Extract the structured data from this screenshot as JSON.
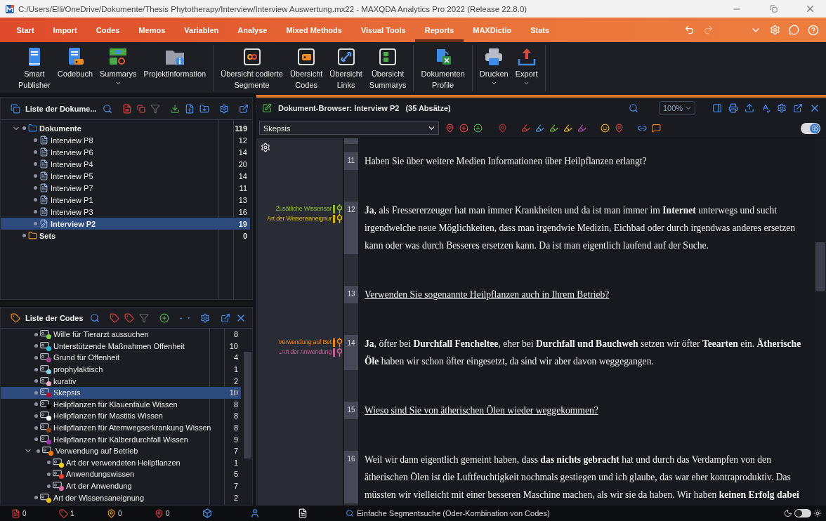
{
  "window": {
    "title": "C:/Users/Elli/OneDrive/Dokumente/Thesis Phytotherapy/Interview/Interview Auswertung.mx22 - MAXQDA Analytics Pro 2022 (Release 22.8.0)"
  },
  "menu_tabs": [
    {
      "label": "Start",
      "selected": false
    },
    {
      "label": "Import",
      "selected": false
    },
    {
      "label": "Codes",
      "selected": false
    },
    {
      "label": "Memos",
      "selected": false
    },
    {
      "label": "Variablen",
      "selected": false
    },
    {
      "label": "Analyse",
      "selected": false
    },
    {
      "label": "Mixed Methods",
      "selected": false
    },
    {
      "label": "Visual Tools",
      "selected": false
    },
    {
      "label": "Reports",
      "selected": true
    },
    {
      "label": "MAXDictio",
      "selected": false
    },
    {
      "label": "Stats",
      "selected": false
    }
  ],
  "ribbon": {
    "groups": [
      [
        {
          "lines": [
            "Smart",
            "Publisher"
          ],
          "dropdown": false
        },
        {
          "lines": [
            "Codebuch"
          ],
          "dropdown": false
        },
        {
          "lines": [
            "Summarys"
          ],
          "dropdown": true
        },
        {
          "lines": [
            "Projektinformation"
          ],
          "dropdown": false
        }
      ],
      [
        {
          "lines": [
            "Übersicht codierte",
            "Segmente"
          ],
          "dropdown": false
        },
        {
          "lines": [
            "Übersicht",
            "Codes"
          ],
          "dropdown": false
        },
        {
          "lines": [
            "Übersicht",
            "Links"
          ],
          "dropdown": false
        },
        {
          "lines": [
            "Übersicht",
            "Summarys"
          ],
          "dropdown": false
        }
      ],
      [
        {
          "lines": [
            "Dokumenten",
            "Profile"
          ],
          "dropdown": false
        }
      ],
      [
        {
          "lines": [
            "Drucken"
          ],
          "dropdown": true
        },
        {
          "lines": [
            "Export"
          ],
          "dropdown": true
        }
      ]
    ]
  },
  "documents_panel": {
    "title": "Liste der Dokume...",
    "tree": [
      {
        "label": "Dokumente",
        "count": "119",
        "kind": "folder",
        "expanded": true,
        "selected": false,
        "children": [
          {
            "label": "Interview P8",
            "count": "12",
            "kind": "document",
            "selected": false
          },
          {
            "label": "Interview P6",
            "count": "14",
            "kind": "document",
            "selected": false
          },
          {
            "label": "Interview P4",
            "count": "20",
            "kind": "document",
            "selected": false
          },
          {
            "label": "Interview P5",
            "count": "14",
            "kind": "document",
            "selected": false
          },
          {
            "label": "Interview P7",
            "count": "11",
            "kind": "document",
            "selected": false
          },
          {
            "label": "Interview P1",
            "count": "13",
            "kind": "document",
            "selected": false
          },
          {
            "label": "Interview P3",
            "count": "16",
            "kind": "document",
            "selected": false
          },
          {
            "label": "Interview P2",
            "count": "19",
            "kind": "document",
            "selected": true
          }
        ]
      },
      {
        "label": "Sets",
        "count": "0",
        "kind": "set",
        "selected": false
      }
    ]
  },
  "codes_panel": {
    "title": "Liste der Codes",
    "tree": [
      {
        "label": "Wille für Tierarzt aussuchen",
        "count": "8",
        "color": "#7cd34a",
        "selected": false
      },
      {
        "label": "Unterstützende Maßnahmen Offenheit",
        "count": "10",
        "color": "#22c3e0",
        "selected": false
      },
      {
        "label": "Grund für Offenheit",
        "count": "4",
        "color": "#a8408f",
        "selected": false
      },
      {
        "label": "prophylaktisch",
        "count": "1",
        "color": "#7fd3e6",
        "selected": false
      },
      {
        "label": "kurativ",
        "count": "2",
        "color": "#f4a9c8",
        "selected": false
      },
      {
        "label": "Skepsis",
        "count": "10",
        "color": "#b0102a",
        "selected": true
      },
      {
        "label": "Heilpflanzen für Klauenfäule Wissen",
        "count": "8",
        "color": "#000000",
        "selected": false
      },
      {
        "label": "Heilpflanzen für Mastitis Wissen",
        "count": "8",
        "color": "#ffffff",
        "selected": false
      },
      {
        "label": "Heilpflanzen für Atemwegserkrankung Wissen",
        "count": "8",
        "color": "#8b4513",
        "selected": false
      },
      {
        "label": "Heilpflanzen für Kälberdurchfall Wissen",
        "count": "9",
        "color": "#9b2fae",
        "selected": false
      },
      {
        "label": "Verwendung auf Betrieb",
        "count": "7",
        "color": "#f07a10",
        "selected": false,
        "expanded": true,
        "children": [
          {
            "label": "Art der verwendeten Heilpflanzen",
            "count": "1",
            "color": "#f2d51a",
            "selected": false
          },
          {
            "label": "Anwendungswissen",
            "count": "5",
            "color": "#e8402a",
            "selected": false
          },
          {
            "label": "Art der Anwendung",
            "count": "7",
            "color": "#e06aa0",
            "selected": false
          }
        ]
      },
      {
        "label": "Art der Wissensaneignung",
        "count": "2",
        "color": "#e8c21a",
        "selected": false
      }
    ]
  },
  "document_browser": {
    "title": "Dokument-Browser: Interview P2",
    "paragraph_count": "(35 Absätze)",
    "zoom": "100%",
    "code_select": "Skepsis",
    "paragraphs": [
      {
        "number": "11",
        "underlined": false,
        "text": "Haben Sie über weitere Medien Informationen über Heilpflanzen erlangt?"
      },
      {
        "number": "12",
        "underlined": false,
        "text": "**Ja**, als Fressererzeuger hat man immer Krankheiten und da ist man immer im **Internet** unterwegs und sucht irgendwelche neue Möglichkeiten, dass man irgendwie Medizin, Eichbad oder durch irgendwas anderes ersetzen kann oder was durch Besseres ersetzen kann. Da ist man eigentlich laufend auf der Suche.",
        "codings": [
          {
            "label": "Zusätliche Wissensar",
            "color": "#8fb82e"
          },
          {
            "label": "Art der Wissensaneignur",
            "color": "#d6b40a"
          }
        ]
      },
      {
        "number": "13",
        "underlined": true,
        "text": "Verwenden Sie sogenannte Heilpflanzen auch in Ihrem Betrieb?"
      },
      {
        "number": "14",
        "underlined": false,
        "text": "**Ja**, öfter bei **Durchfall Fencheltee**, eher bei **Durchfall und Bauchweh** setzen wir öfter **Teearten** ein. **Ätherische Öle** haben wir schon öfter eingesetzt, da sind wir aber davon weggegangen.",
        "codings": [
          {
            "label": "Verwendung auf Bet",
            "color": "#e8821e"
          },
          {
            "label": "..Art der Anwendung",
            "color": "#c8609a"
          }
        ]
      },
      {
        "number": "15",
        "underlined": true,
        "text": "Wieso sind Sie von ätherischen Ölen wieder weggekommen?"
      },
      {
        "number": "16",
        "underlined": false,
        "text": "Weil wir dann eigentlich gemeint haben, dass **das nichts gebracht** hat und durch das Verdampfen von den ätherischen Ölen ist die Luftfeuchtigkeit nochmals gestiegen und ich glaube, das war eher kontraproduktiv. Das müssten wir vielleicht mit einer besseren Maschine machen, als wir sie da haben. Wir haben **keinen Erfolg dabei**"
      }
    ],
    "edit_mode": true
  },
  "status_bar": {
    "light_mode": false,
    "counts": [
      "0",
      "1",
      "0",
      "0"
    ],
    "search_mode": "Einfache Segmentsuche (Oder-Kombination von Codes)"
  }
}
